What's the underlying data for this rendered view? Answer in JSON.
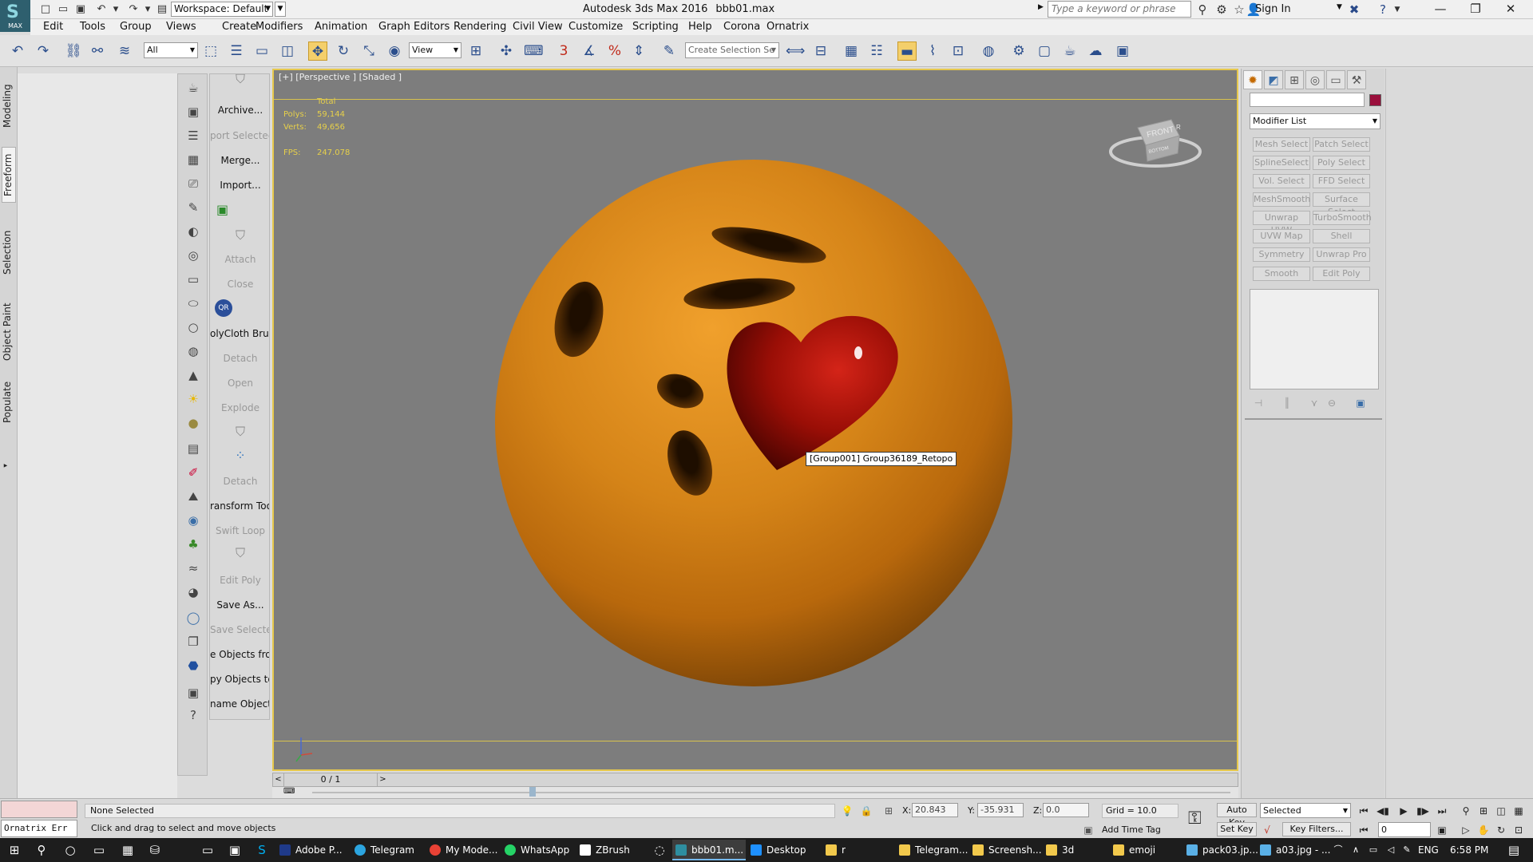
{
  "titlebar": {
    "app_logo_text": "MAX",
    "workspace": "Workspace: Default",
    "app_title": "Autodesk 3ds Max 2016",
    "file_name": "bbb01.max",
    "search_placeholder": "Type a keyword or phrase",
    "sign_in": "Sign In"
  },
  "menu": [
    "Edit",
    "Tools",
    "Group",
    "Views",
    "Create",
    "Modifiers",
    "Animation",
    "Graph Editors",
    "Rendering",
    "Civil View",
    "Customize",
    "Scripting",
    "Help",
    "Corona",
    "Ornatrix"
  ],
  "main_toolbar": {
    "selection_filter": "All",
    "reference_coord": "View",
    "selection_set": "Create Selection Se",
    "snap_3_label": "3",
    "snap_percent_label": "%"
  },
  "ribbon_tabs": [
    "Modeling",
    "Freeform",
    "Selection",
    "Object Paint",
    "Populate"
  ],
  "ribbon_active_tab": "Freeform",
  "tool_panel": {
    "items": [
      {
        "label": "Archive...",
        "enabled": true
      },
      {
        "label": "port Selected",
        "enabled": false
      },
      {
        "label": "Merge...",
        "enabled": true
      },
      {
        "label": "Import...",
        "enabled": true
      },
      {
        "label": "Attach",
        "enabled": false
      },
      {
        "label": "Close",
        "enabled": false
      },
      {
        "label": "olyCloth Brush",
        "enabled": true
      },
      {
        "label": "Detach",
        "enabled": false
      },
      {
        "label": "Open",
        "enabled": false
      },
      {
        "label": "Explode",
        "enabled": false
      },
      {
        "label": "Detach",
        "enabled": false
      },
      {
        "label": "ransform Tool",
        "enabled": true
      },
      {
        "label": "Swift Loop",
        "enabled": false
      },
      {
        "label": "Edit Poly",
        "enabled": false
      },
      {
        "label": "Save As...",
        "enabled": true
      },
      {
        "label": "Save Selected",
        "enabled": false
      },
      {
        "label": "e Objects fron",
        "enabled": true
      },
      {
        "label": "py Objects to",
        "enabled": true
      },
      {
        "label": "name Objects",
        "enabled": true
      }
    ],
    "qr_label": "QR"
  },
  "viewport": {
    "label": "[+] [Perspective ] [Shaded ]",
    "stats": {
      "total_label": "Total",
      "polys_label": "Polys:",
      "polys_value": "59,144",
      "verts_label": "Verts:",
      "verts_value": "49,656",
      "fps_label": "FPS:",
      "fps_value": "247.078"
    },
    "tooltip": "[Group001] Group36189_Retopo",
    "viewcube_face": "FRONT",
    "viewcube_side": "R",
    "viewcube_bottom": "BOTTOM",
    "colors": {
      "border": "#e6c84c",
      "background": "#7d7d7d",
      "emoji": "#d58418",
      "heart": "#8e0b06"
    }
  },
  "command_panel": {
    "tabs": [
      "create-icon",
      "modify-icon",
      "hierarchy-icon",
      "motion-icon",
      "display-icon",
      "utilities-icon"
    ],
    "modifier_list": "Modifier List",
    "modifier_buttons": [
      "Mesh Select",
      "Patch Select",
      "SplineSelect",
      "Poly Select",
      "Vol. Select",
      "FFD Select",
      "MeshSmooth",
      "Surface Select",
      "Unwrap UVW",
      "TurboSmooth",
      "UVW Map",
      "Shell",
      "Symmetry",
      "Unwrap Pro",
      "Smooth",
      "Edit Poly"
    ],
    "object_color": "#9a0f3c"
  },
  "timeline": {
    "frame": "0 / 1",
    "left": "<",
    "right": ">"
  },
  "status": {
    "maxscript_text": "Ornatrix Err",
    "selection": "None Selected",
    "prompt": "Click and drag to select and move objects",
    "x_label": "X:",
    "x_value": "20.843",
    "y_label": "Y:",
    "y_value": "-35.931",
    "z_label": "Z:",
    "z_value": "0.0",
    "grid": "Grid = 10.0",
    "add_time_tag": "Add Time Tag",
    "auto_key": "Auto Key",
    "set_key": "Set Key",
    "selected_dd": "Selected",
    "key_filters": "Key Filters...",
    "current_frame": "0"
  },
  "taskbar": {
    "apps": [
      {
        "label": "Adobe P...",
        "color": "#1f3a8a"
      },
      {
        "label": "Telegram",
        "color": "#2ca5e0"
      },
      {
        "label": "My Mode...",
        "color": "#e94235"
      },
      {
        "label": "WhatsApp",
        "color": "#25d366"
      },
      {
        "label": "ZBrush",
        "color": "#ffffff"
      },
      {
        "label": "bbb01.m...",
        "color": "#2e8ea0"
      },
      {
        "label": "Desktop",
        "color": "#1e90ff"
      },
      {
        "label": "r",
        "color": "#f2c94c"
      },
      {
        "label": "Telegram...",
        "color": "#f2c94c"
      },
      {
        "label": "Screensh...",
        "color": "#f2c94c"
      },
      {
        "label": "3d",
        "color": "#f2c94c"
      },
      {
        "label": "emoji",
        "color": "#f2c94c"
      },
      {
        "label": "pack03.jp...",
        "color": "#5ab0e6"
      },
      {
        "label": "a03.jpg - ...",
        "color": "#5ab0e6"
      }
    ],
    "language": "ENG",
    "time": "6:58 PM"
  }
}
